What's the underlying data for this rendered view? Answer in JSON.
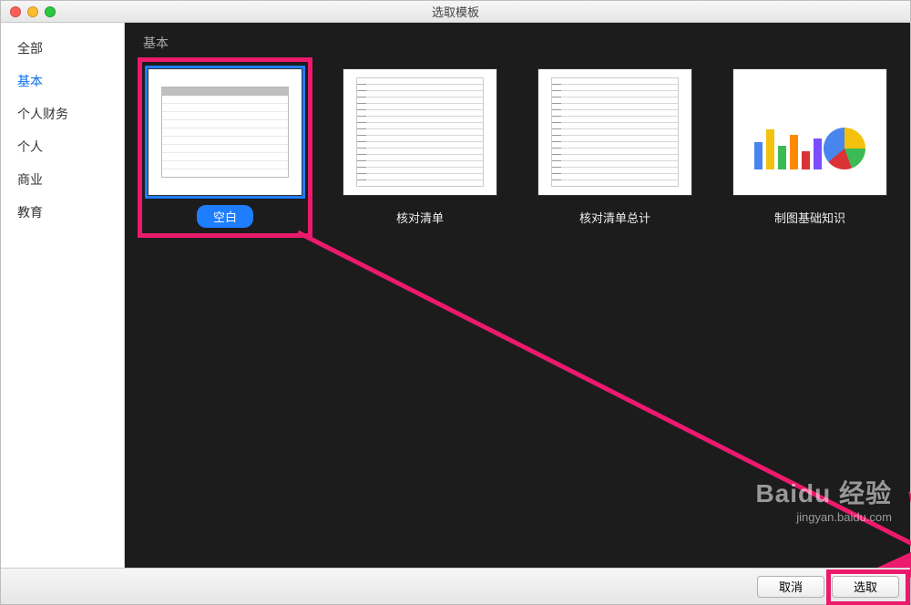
{
  "window": {
    "title": "选取模板"
  },
  "sidebar": {
    "items": [
      {
        "label": "全部"
      },
      {
        "label": "基本"
      },
      {
        "label": "个人财务"
      },
      {
        "label": "个人"
      },
      {
        "label": "商业"
      },
      {
        "label": "教育"
      }
    ],
    "active_index": 1
  },
  "main": {
    "section_title": "基本",
    "templates": [
      {
        "label": "空白",
        "selected": true
      },
      {
        "label": "核对清单",
        "selected": false
      },
      {
        "label": "核对清单总计",
        "selected": false
      },
      {
        "label": "制图基础知识",
        "selected": false
      }
    ]
  },
  "footer": {
    "cancel_label": "取消",
    "choose_label": "选取"
  },
  "watermark": {
    "brand": "Baidu 经验",
    "url": "jingyan.baidu.com"
  },
  "annotation": {
    "highlight_color": "#ec1a6d"
  }
}
